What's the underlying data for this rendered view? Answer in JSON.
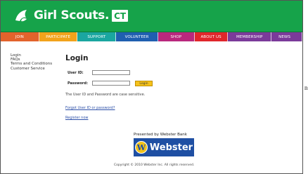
{
  "brand": {
    "name": "Girl Scouts.",
    "badge": "CT",
    "logo_icon": "trefoil-profile-icon",
    "green": "#16a34a"
  },
  "nav": {
    "items": [
      {
        "label": "JOIN",
        "color": "#e2632c"
      },
      {
        "label": "PARTICIPATE",
        "color": "#f2a31b"
      },
      {
        "label": "SUPPORT",
        "color": "#1aa6a0"
      },
      {
        "label": "VOLUNTEER",
        "color": "#1f5fb0"
      },
      {
        "label": "SHOP",
        "color": "#b9287d"
      },
      {
        "label": "ABOUT US",
        "color": "#e0262b"
      },
      {
        "label": "MEMBERSHIP",
        "color": "#7b3a9a"
      },
      {
        "label": "NEWS",
        "color": "#7b3a9a"
      }
    ]
  },
  "sidebar": {
    "items": [
      "Login",
      "FAQs",
      "Terms and Conditions",
      "Customer Service"
    ]
  },
  "login": {
    "heading": "Login",
    "user_id_label": "User ID:",
    "user_id_value": "",
    "password_label": "Password:",
    "password_value": "",
    "button_label": "Login",
    "note": "The User ID and Password are case sensitive.",
    "forgot_link": "Forgot User ID or password?",
    "register_link": "Register now"
  },
  "sponsor": {
    "presented_by": "Presented by Webster Bank",
    "mark": "W",
    "name": "Webster",
    "brand_color": "#1f4fa3"
  },
  "footer": {
    "copyright": "Copyright © 2010 Webster Inc. All rights reserved."
  },
  "edge_letter": "n"
}
